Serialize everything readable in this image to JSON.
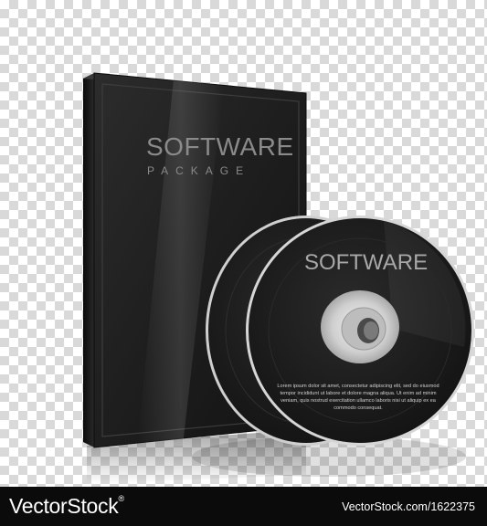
{
  "box": {
    "title": "SOFTWARE",
    "subtitle": "PACKAGE"
  },
  "disc": {
    "title": "SOFTWARE",
    "body_text": "Lorem ipsum dolor sit amet, consectetur adipiscing elit, sed do eiusmod tempor incididunt ut labore et dolore magna aliqua. Ut enim ad minim veniam, quis nostrud exercitation ullamco laboris nisi ut aliquip ex ea commodo consequat."
  },
  "footer": {
    "brand": "VectorStock",
    "trademark": "®",
    "credit": "VectorStock.com/1622375"
  },
  "colors": {
    "case": "#222222",
    "disc": "#1a1a1a",
    "footer": "#0b0b0b",
    "checker": "#d9d9d9"
  }
}
